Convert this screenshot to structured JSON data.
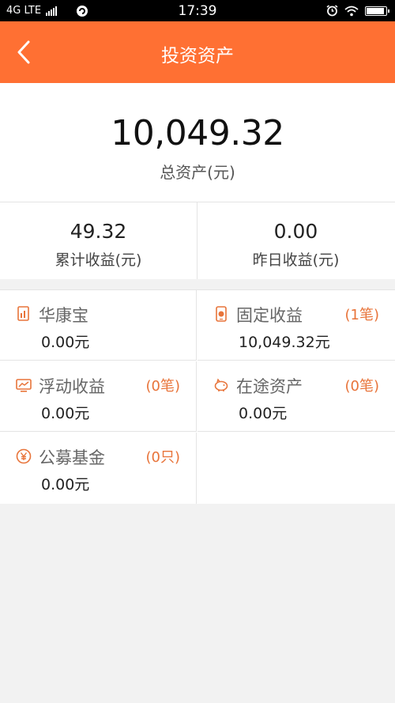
{
  "status_bar": {
    "network": "4G LTE",
    "time": "17:39"
  },
  "nav": {
    "title": "投资资产",
    "back_icon": "chevron-left-icon"
  },
  "summary": {
    "total_value": "10,049.32",
    "total_label": "总资产(元)"
  },
  "stats": [
    {
      "value": "49.32",
      "label": "累计收益(元)"
    },
    {
      "value": "0.00",
      "label": "昨日收益(元)"
    }
  ],
  "categories": [
    {
      "title": "华康宝",
      "value": "0.00元",
      "count": "",
      "icon": "document-icon"
    },
    {
      "title": "固定收益",
      "value": "10,049.32元",
      "count": "(1笔)",
      "icon": "phone-coin-icon"
    },
    {
      "title": "浮动收益",
      "value": "0.00元",
      "count": "(0笔)",
      "icon": "monitor-icon"
    },
    {
      "title": "在途资产",
      "value": "0.00元",
      "count": "(0笔)",
      "icon": "piggy-bank-icon"
    },
    {
      "title": "公募基金",
      "value": "0.00元",
      "count": "(0只)",
      "icon": "yen-coin-icon"
    }
  ],
  "colors": {
    "accent": "#ff7033",
    "count_text": "#e8743a",
    "background": "#f2f2f2"
  }
}
